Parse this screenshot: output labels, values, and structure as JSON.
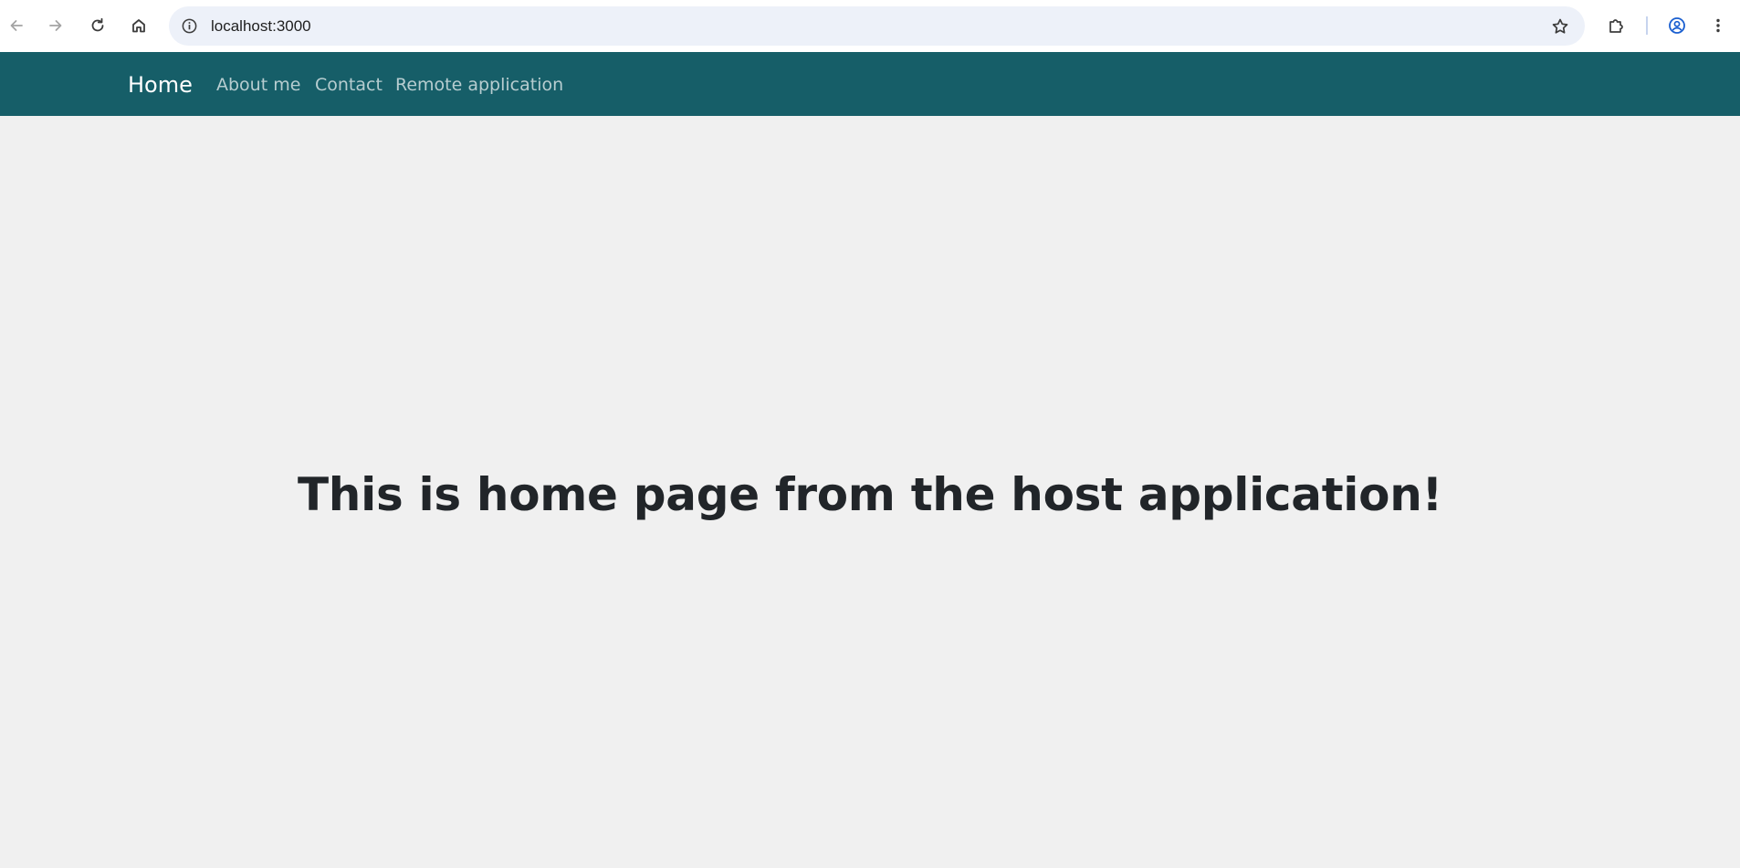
{
  "browser": {
    "url": "localhost:3000",
    "icons": {
      "back": "arrow-left-icon",
      "forward": "arrow-right-icon",
      "reload": "reload-icon",
      "home": "home-icon",
      "site_info": "info-icon",
      "bookmark": "star-icon",
      "extensions": "puzzle-icon",
      "profile": "account-circle-icon",
      "menu": "kebab-menu-icon"
    }
  },
  "navbar": {
    "brand": "Home",
    "links": [
      {
        "label": "About me"
      },
      {
        "label": "Contact"
      },
      {
        "label": "Remote application"
      }
    ],
    "colors": {
      "background": "#165e68",
      "brand_text": "#ffffff",
      "link_text": "#b7cdd0"
    }
  },
  "main": {
    "heading": "This is home page from the host application!",
    "colors": {
      "background": "#f0f0f0",
      "heading_text": "#212529"
    }
  }
}
